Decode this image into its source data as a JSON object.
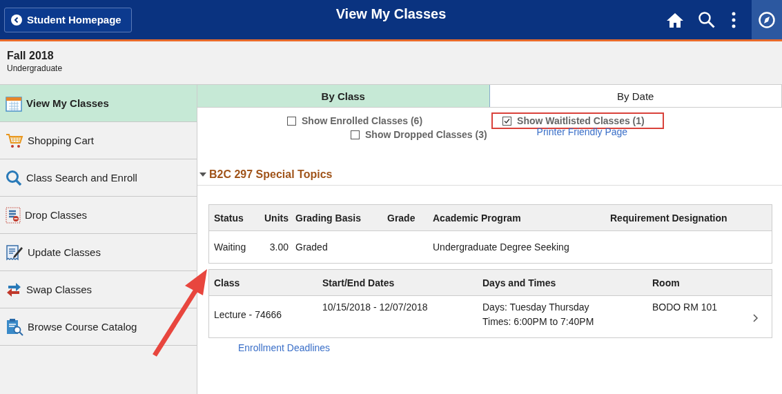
{
  "header": {
    "back_button": "Student Homepage",
    "title": "View My Classes"
  },
  "term": {
    "name": "Fall 2018",
    "career": "Undergraduate"
  },
  "sidebar": {
    "items": [
      {
        "label": "View My Classes",
        "selected": true
      },
      {
        "label": "Shopping Cart",
        "selected": false
      },
      {
        "label": "Class Search and Enroll",
        "selected": false
      },
      {
        "label": "Drop Classes",
        "selected": false
      },
      {
        "label": "Update Classes",
        "selected": false
      },
      {
        "label": "Swap Classes",
        "selected": false
      },
      {
        "label": "Browse Course Catalog",
        "selected": false
      }
    ]
  },
  "tabs": [
    {
      "label": "By Class",
      "selected": true
    },
    {
      "label": "By Date",
      "selected": false
    }
  ],
  "filters": [
    {
      "label": "Show Enrolled Classes (6)",
      "checked": false,
      "highlighted": false
    },
    {
      "label": "Show Waitlisted Classes (1)",
      "checked": true,
      "highlighted": true
    },
    {
      "label": "Show Dropped Classes (3)",
      "checked": false,
      "highlighted": false
    }
  ],
  "printer_link": "Printer Friendly Page",
  "course": {
    "title": "B2C 297 Special Topics",
    "expanded": true,
    "summary": {
      "columns": [
        "Status",
        "Units",
        "Grading Basis",
        "Grade",
        "Academic Program",
        "Requirement Designation"
      ],
      "row": {
        "status": "Waiting",
        "units": "3.00",
        "grading_basis": "Graded",
        "academic_program": "Undergraduate Degree Seeking"
      }
    },
    "sections": {
      "columns": [
        "Class",
        "Start/End Dates",
        "Days and Times",
        "Room"
      ],
      "row": {
        "class": "Lecture - 74666",
        "dates": "10/15/2018 - 12/07/2018",
        "days": "Days: Tuesday Thursday",
        "times": "Times: 6:00PM to 7:40PM",
        "room": "BODO RM 101"
      }
    }
  },
  "deadlines_link": "Enrollment Deadlines"
}
